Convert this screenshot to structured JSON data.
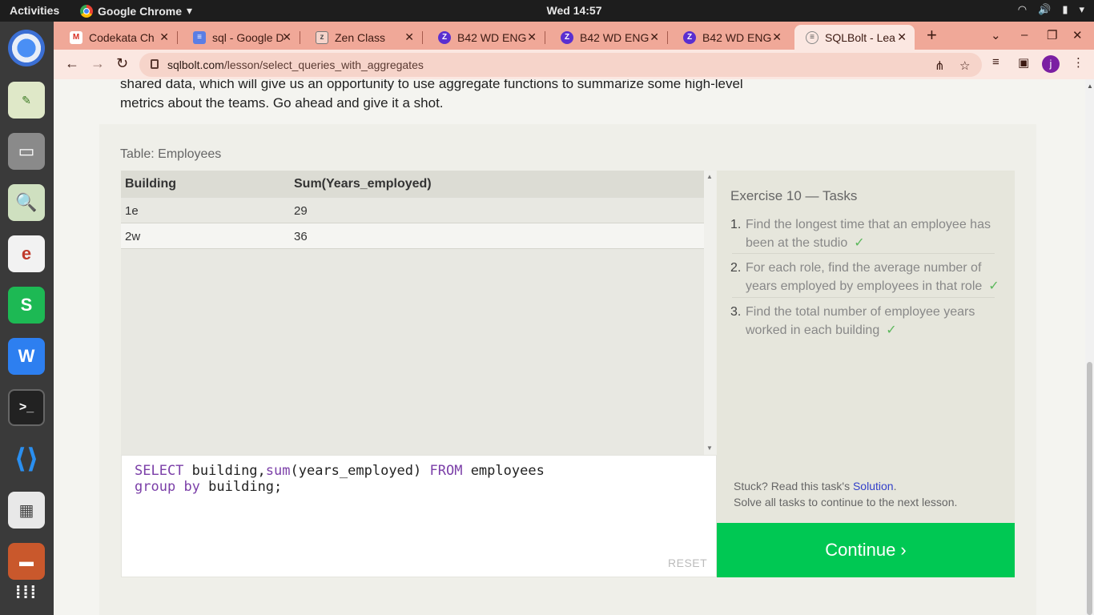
{
  "topbar": {
    "activities": "Activities",
    "app_name": "Google Chrome",
    "clock": "Wed 14:57"
  },
  "tabs": [
    {
      "title": "Codekata Ch",
      "favicon": "gmail-icon"
    },
    {
      "title": "sql - Google D",
      "favicon": "docs-icon"
    },
    {
      "title": "Zen Class",
      "favicon": "zen-icon"
    },
    {
      "title": "B42 WD ENG",
      "favicon": "zoom-icon"
    },
    {
      "title": "B42 WD ENG",
      "favicon": "zoom-icon"
    },
    {
      "title": "B42 WD ENG",
      "favicon": "zoom-icon"
    },
    {
      "title": "SQLBolt - Lea",
      "favicon": "sqlbolt-icon"
    }
  ],
  "omnibox": {
    "domain": "sqlbolt.com",
    "path": "/lesson/select_queries_with_aggregates"
  },
  "avatar_letter": "j",
  "intro": {
    "line1": "shared data, which will give us an opportunity to use aggregate functions to summarize some high-level",
    "line2": "metrics about the teams. Go ahead and give it a shot."
  },
  "table": {
    "label": "Table: Employees",
    "columns": [
      "Building",
      "Sum(Years_employed)"
    ],
    "rows": [
      [
        "1e",
        "29"
      ],
      [
        "2w",
        "36"
      ]
    ]
  },
  "editor": {
    "kw_select": "SELECT",
    "t1": " building,",
    "fn_sum": "sum",
    "t2": "(years_employed) ",
    "kw_from": "FROM",
    "t3": " employees",
    "kw_group": "group",
    "kw_by": "by",
    "t4": " building;",
    "reset_label": "RESET"
  },
  "tasks": {
    "title": "Exercise 10 — Tasks",
    "items": [
      {
        "num": "1.",
        "text": "Find the longest time that an employee has been at the studio",
        "check": "✓"
      },
      {
        "num": "2.",
        "text": "For each role, find the average number of years employed by employees in that role",
        "check": "✓"
      },
      {
        "num": "3.",
        "text": "Find the total number of employee years worked in each building",
        "check": "✓"
      }
    ],
    "stuck_prefix": "Stuck? Read this task's ",
    "solution_link": "Solution",
    "stuck_suffix": ".",
    "solve_all": "Solve all tasks to continue to the next lesson."
  },
  "continue_label": "Continue ›"
}
